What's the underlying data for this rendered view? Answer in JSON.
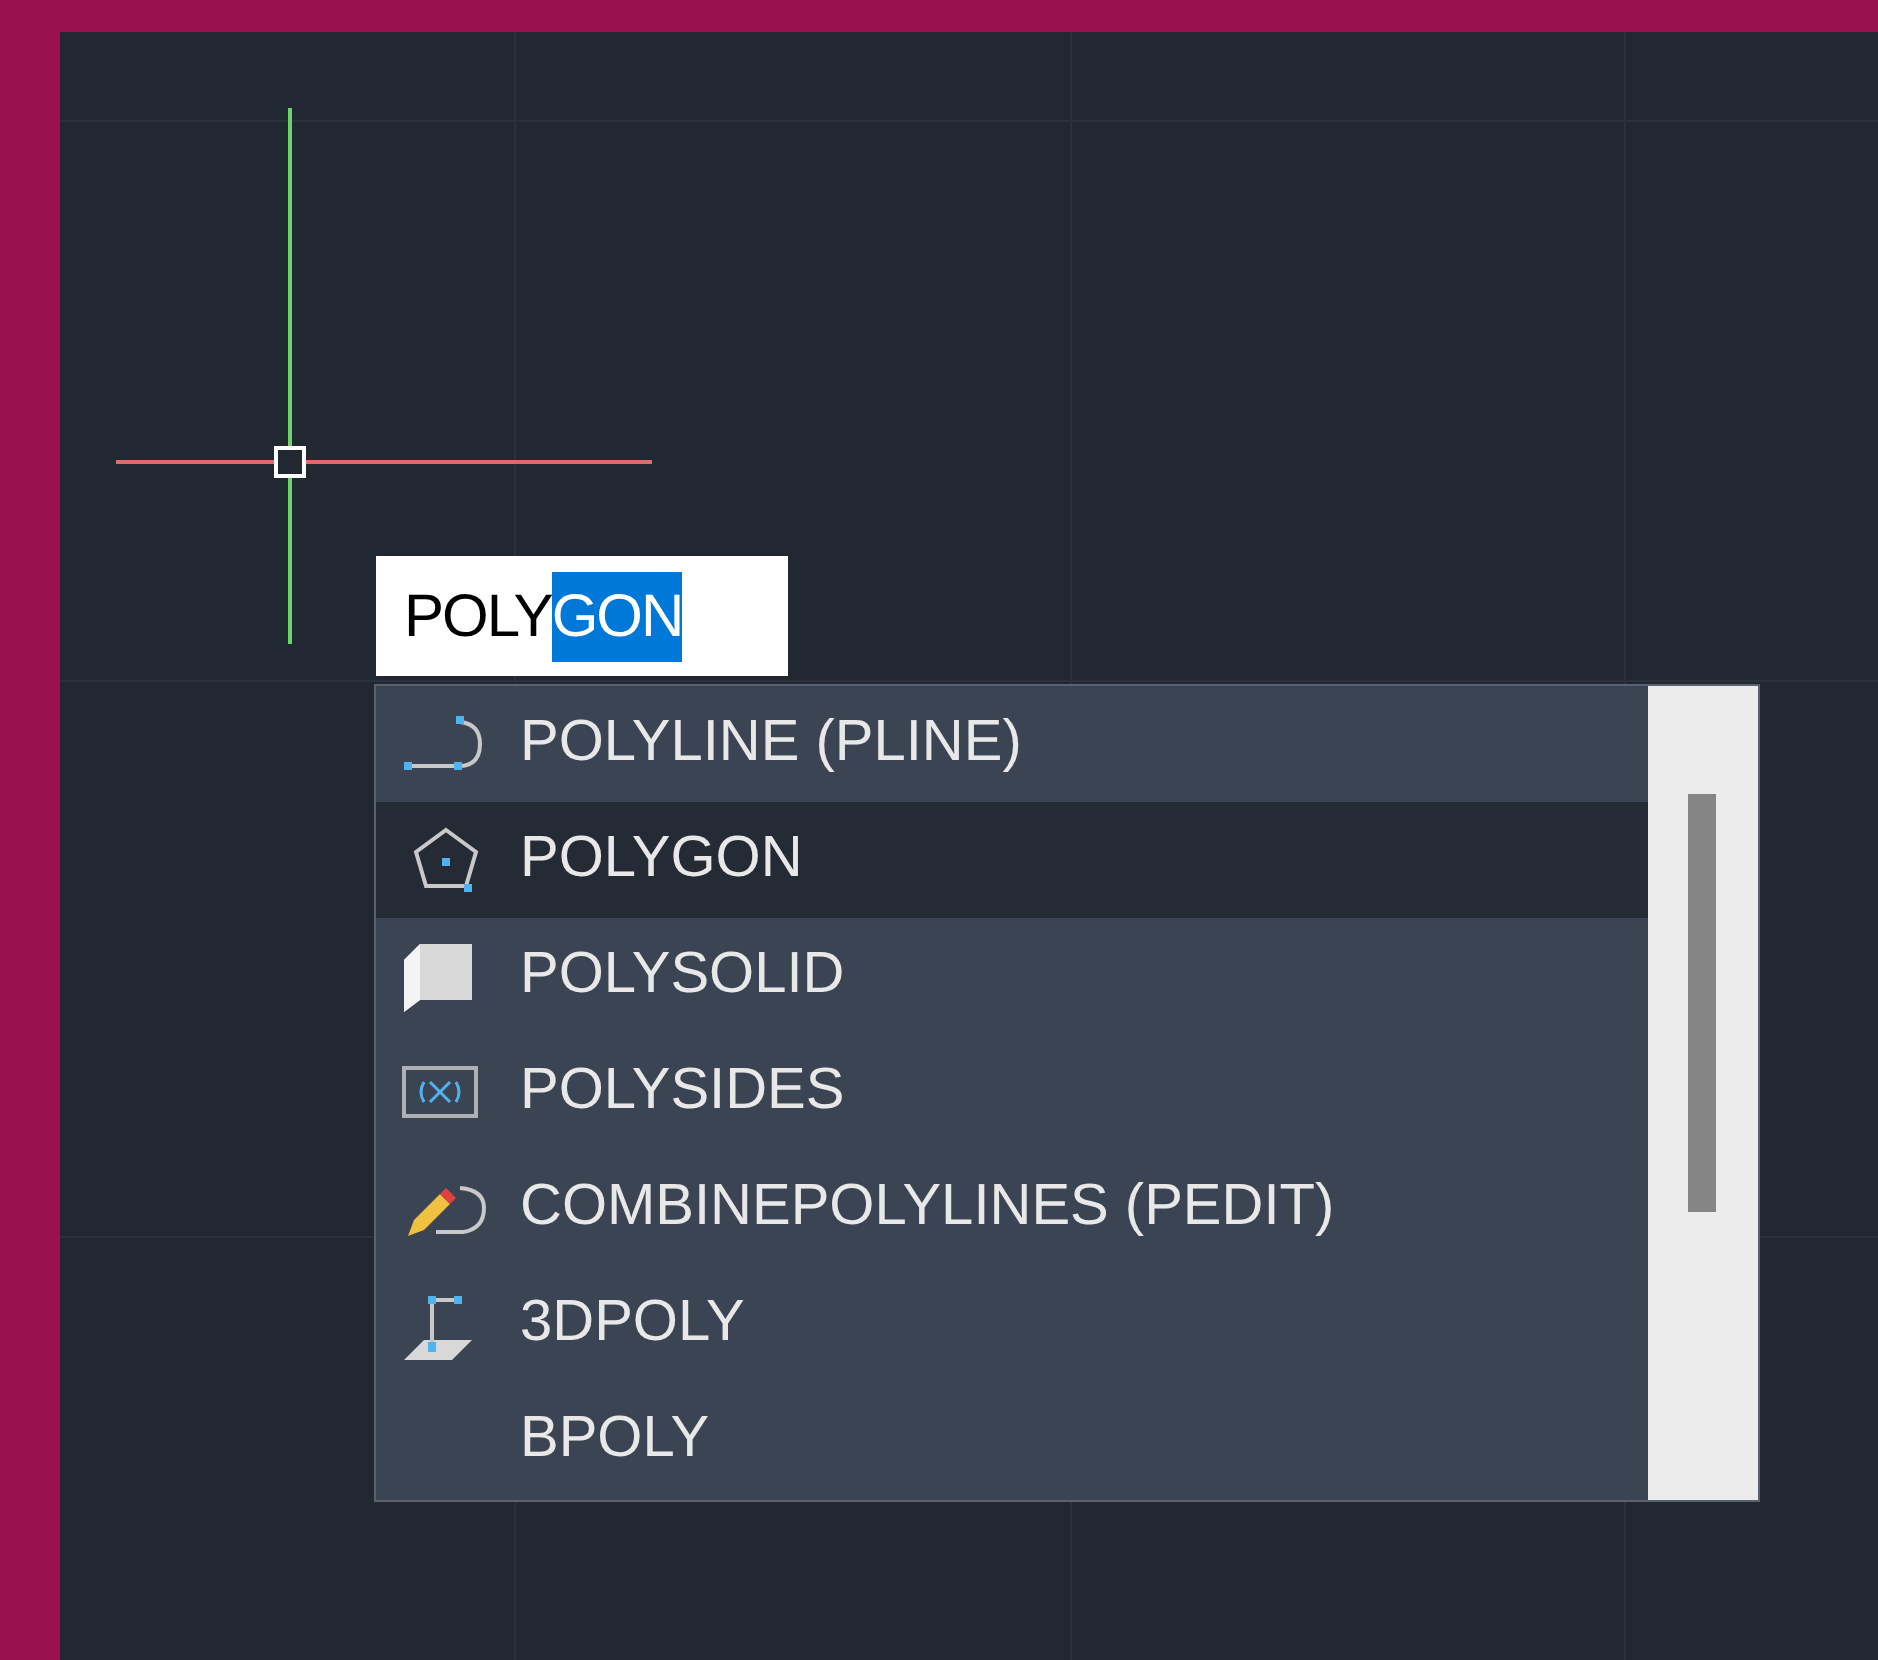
{
  "command_input": {
    "typed": "POLY",
    "completion": "GON"
  },
  "suggestions": [
    {
      "label": "POLYLINE (PLINE)",
      "kind": "polyline",
      "selected": false
    },
    {
      "label": "POLYGON",
      "kind": "polygon",
      "selected": true
    },
    {
      "label": "POLYSOLID",
      "kind": "polysolid",
      "selected": false
    },
    {
      "label": "POLYSIDES",
      "kind": "polysides",
      "selected": false
    },
    {
      "label": "COMBINEPOLYLINES (PEDIT)",
      "kind": "pedit",
      "selected": false
    },
    {
      "label": "3DPOLY",
      "kind": "spatial",
      "selected": false
    },
    {
      "label": "BPOLY",
      "kind": "none",
      "selected": false
    }
  ]
}
